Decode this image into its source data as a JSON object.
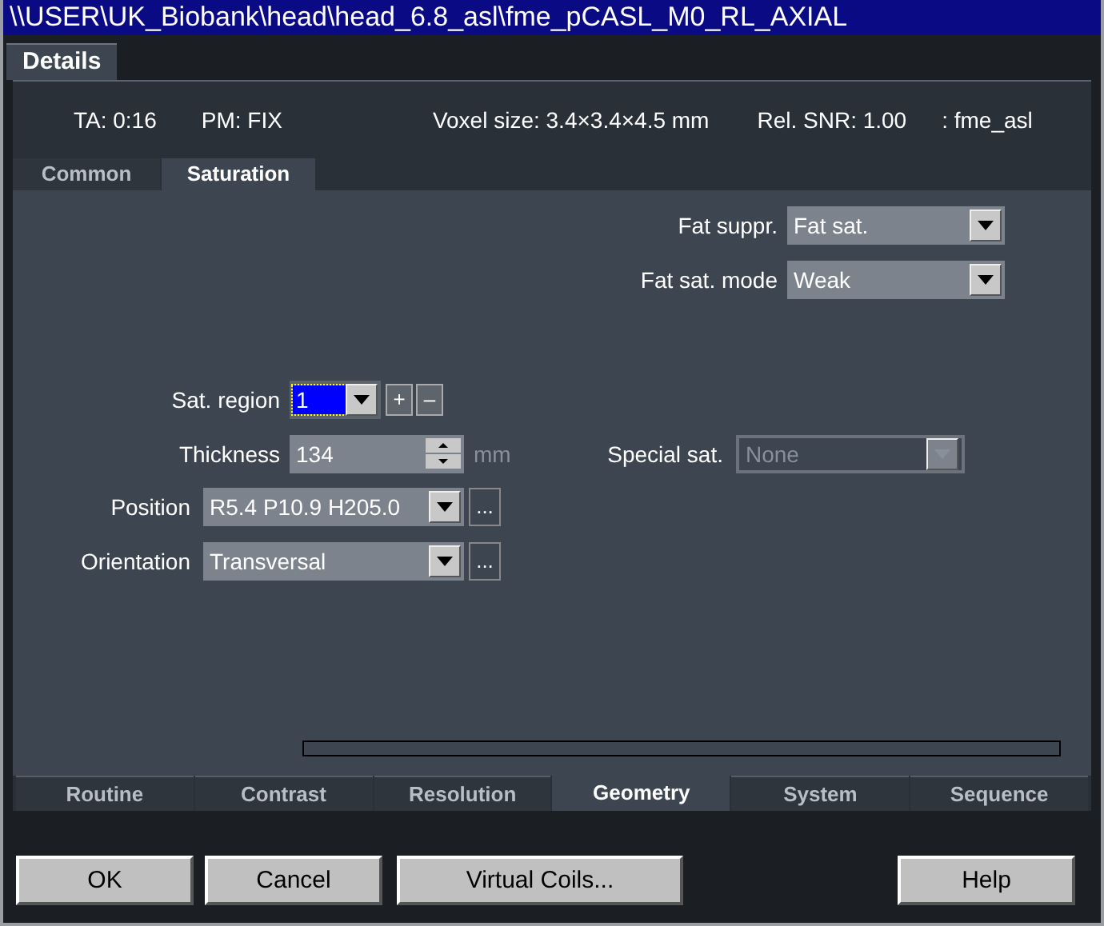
{
  "window": {
    "title": "\\\\USER\\UK_Biobank\\head\\head_6.8_asl\\fme_pCASL_M0_RL_AXIAL"
  },
  "top_tabs": [
    {
      "label": "Details",
      "selected": true
    }
  ],
  "info": [
    "TA: 0:16",
    "PM: FIX",
    "Voxel size: 3.4×3.4×4.5 mm",
    "Rel. SNR: 1.00",
    ": fme_asl"
  ],
  "subtabs": [
    {
      "label": "Common",
      "selected": false
    },
    {
      "label": "Saturation",
      "selected": true
    }
  ],
  "fat_suppr": {
    "label": "Fat suppr.",
    "value": "Fat sat."
  },
  "fat_sat_mode": {
    "label": "Fat sat. mode",
    "value": "Weak"
  },
  "sat_region": {
    "label": "Sat. region",
    "value": "1",
    "plus": "+",
    "minus": "–"
  },
  "thickness": {
    "label": "Thickness",
    "value": "134",
    "unit": "mm"
  },
  "special_sat": {
    "label": "Special sat.",
    "value": "None",
    "disabled": true
  },
  "position": {
    "label": "Position",
    "value": "R5.4 P10.9 H205.0",
    "more": "..."
  },
  "orientation": {
    "label": "Orientation",
    "value": "Transversal",
    "more": "..."
  },
  "bottom_tabs": [
    {
      "label": "Routine",
      "selected": false
    },
    {
      "label": "Contrast",
      "selected": false
    },
    {
      "label": "Resolution",
      "selected": false
    },
    {
      "label": "Geometry",
      "selected": true
    },
    {
      "label": "System",
      "selected": false
    },
    {
      "label": "Sequence",
      "selected": false
    }
  ],
  "buttons": [
    "OK",
    "Cancel",
    "Virtual Coils...",
    "Help"
  ]
}
